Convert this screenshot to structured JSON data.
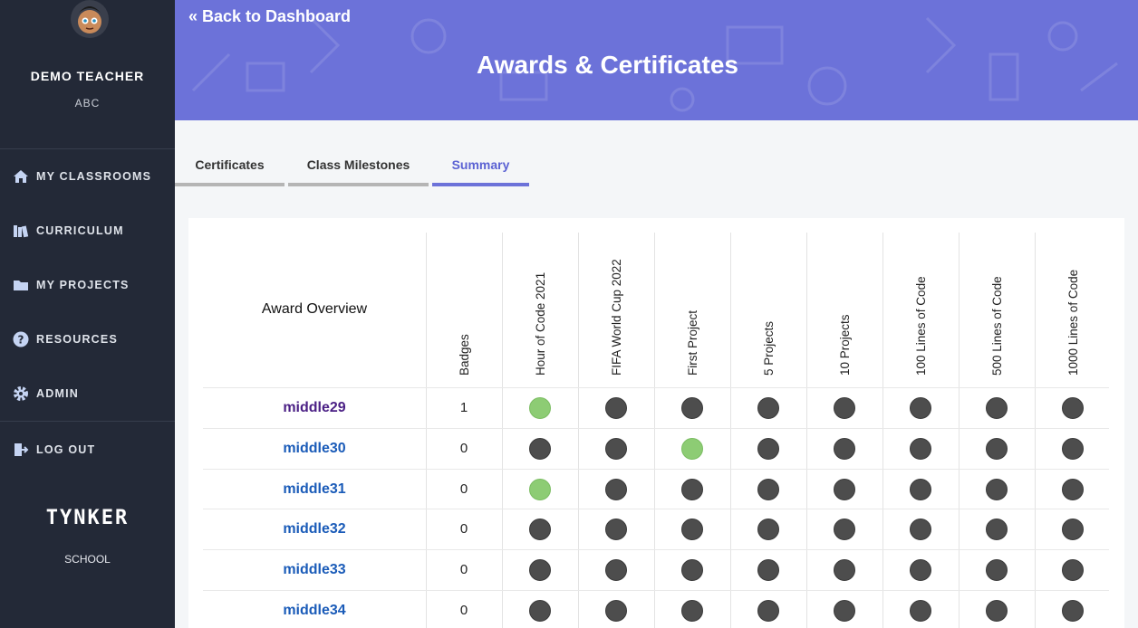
{
  "sidebar": {
    "teacher_name": "DEMO TEACHER",
    "teacher_org": "ABC",
    "items": [
      {
        "label": "MY CLASSROOMS",
        "icon": "home-icon"
      },
      {
        "label": "CURRICULUM",
        "icon": "books-icon"
      },
      {
        "label": "MY PROJECTS",
        "icon": "folder-icon"
      },
      {
        "label": "RESOURCES",
        "icon": "help-icon"
      },
      {
        "label": "ADMIN",
        "icon": "gear-icon"
      },
      {
        "label": "LOG OUT",
        "icon": "logout-icon"
      }
    ],
    "logo_text": "TYNKER",
    "logo_sub": "SCHOOL"
  },
  "header": {
    "back_link": "« Back to Dashboard",
    "title": "Awards & Certificates"
  },
  "tabs": [
    {
      "label": "Certificates",
      "active": false
    },
    {
      "label": "Class Milestones",
      "active": false
    },
    {
      "label": "Summary",
      "active": true
    }
  ],
  "table": {
    "overview_label": "Award Overview",
    "columns": [
      "Badges",
      "Hour of Code 2021",
      "FIFA World Cup 2022",
      "First Project",
      "5 Projects",
      "10 Projects",
      "100 Lines of Code",
      "500 Lines of Code",
      "1000 Lines of Code"
    ],
    "rows": [
      {
        "student": "middle29",
        "badges": "1",
        "earned": [
          true,
          false,
          false,
          false,
          false,
          false,
          false,
          false
        ]
      },
      {
        "student": "middle30",
        "badges": "0",
        "earned": [
          false,
          false,
          true,
          false,
          false,
          false,
          false,
          false
        ]
      },
      {
        "student": "middle31",
        "badges": "0",
        "earned": [
          true,
          false,
          false,
          false,
          false,
          false,
          false,
          false
        ]
      },
      {
        "student": "middle32",
        "badges": "0",
        "earned": [
          false,
          false,
          false,
          false,
          false,
          false,
          false,
          false
        ]
      },
      {
        "student": "middle33",
        "badges": "0",
        "earned": [
          false,
          false,
          false,
          false,
          false,
          false,
          false,
          false
        ]
      },
      {
        "student": "middle34",
        "badges": "0",
        "earned": [
          false,
          false,
          false,
          false,
          false,
          false,
          false,
          false
        ]
      }
    ]
  },
  "colors": {
    "earned": "#8dcc74",
    "not_earned": "#4d4d4d",
    "accent": "#6c72d9",
    "sidebar": "#232937"
  }
}
